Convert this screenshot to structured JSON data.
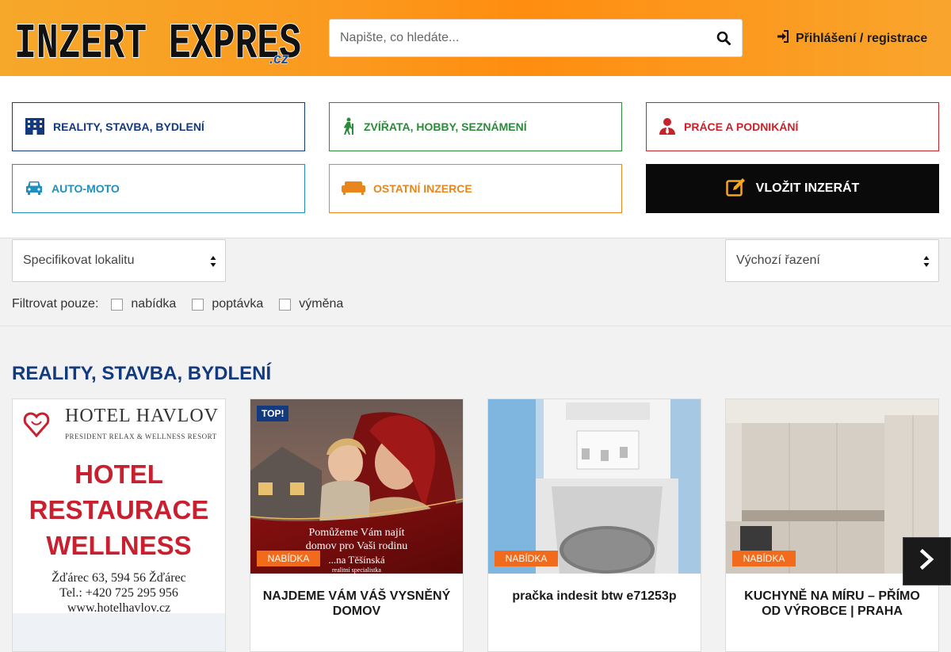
{
  "header": {
    "logo_text": "INZERT EXPRES",
    "logo_suffix": ".cz",
    "search_placeholder": "Napište, co hledáte...",
    "login_label": "Přihlášení / registrace"
  },
  "categories": [
    {
      "label": "REALITY, STAVBA, BYDLENÍ",
      "icon": "building-icon",
      "color": "#13397f"
    },
    {
      "label": "ZVÍŘATA, HOBBY, SEZNÁMENÍ",
      "icon": "hiker-icon",
      "color": "#2d8a3a"
    },
    {
      "label": "PRÁCE A PODNIKÁNÍ",
      "icon": "businessman-icon",
      "color": "#c6232b"
    },
    {
      "label": "AUTO-MOTO",
      "icon": "car-icon",
      "color": "#1f8fbf"
    },
    {
      "label": "OSTATNÍ INZERCE",
      "icon": "couch-icon",
      "color": "#e8861d"
    }
  ],
  "cta": {
    "label": "VLOŽIT INZERÁT",
    "icon": "edit-icon"
  },
  "filters": {
    "locality_select": "Specifikovat lokalitu",
    "sort_select": "Výchozí řazení",
    "filter_label": "Filtrovat pouze:",
    "checkboxes": [
      "nabídka",
      "poptávka",
      "výměna"
    ]
  },
  "section": {
    "title": "REALITY, STAVBA, BYDLENÍ"
  },
  "ad_banner": {
    "brand": "HOTEL HAVLOV",
    "tagline": "PRESIDENT RELAX & WELLNESS RESORT",
    "lines": [
      "HOTEL",
      "RESTAURACE",
      "WELLNESS"
    ],
    "address": "Žďárec 63, 594 56 Žďárec",
    "phone": "Tel.: +420 725 295 956",
    "web": "www.hotelhavlov.cz"
  },
  "listings": [
    {
      "title": "NAJDEME VÁM VÁŠ VYSNĚNÝ DOMOV",
      "badge": "NABÍDKA",
      "top": "TOP!",
      "image_text": [
        "Pomůžeme Vám najít",
        "domov pro Vaši rodinu",
        "...na Těšínská",
        "realitní specialistka"
      ]
    },
    {
      "title": "pračka indesit btw e71253p",
      "badge": "NABÍDKA"
    },
    {
      "title": "KUCHYNĚ NA MÍRU – PŘÍMO OD VÝROBCE | PRAHA",
      "badge": "NABÍDKA"
    }
  ],
  "colors": {
    "header_orange": "#fb9a1f",
    "brand_blue": "#13397f",
    "badge_orange": "#f26a1b",
    "hotel_red": "#c8202f"
  }
}
